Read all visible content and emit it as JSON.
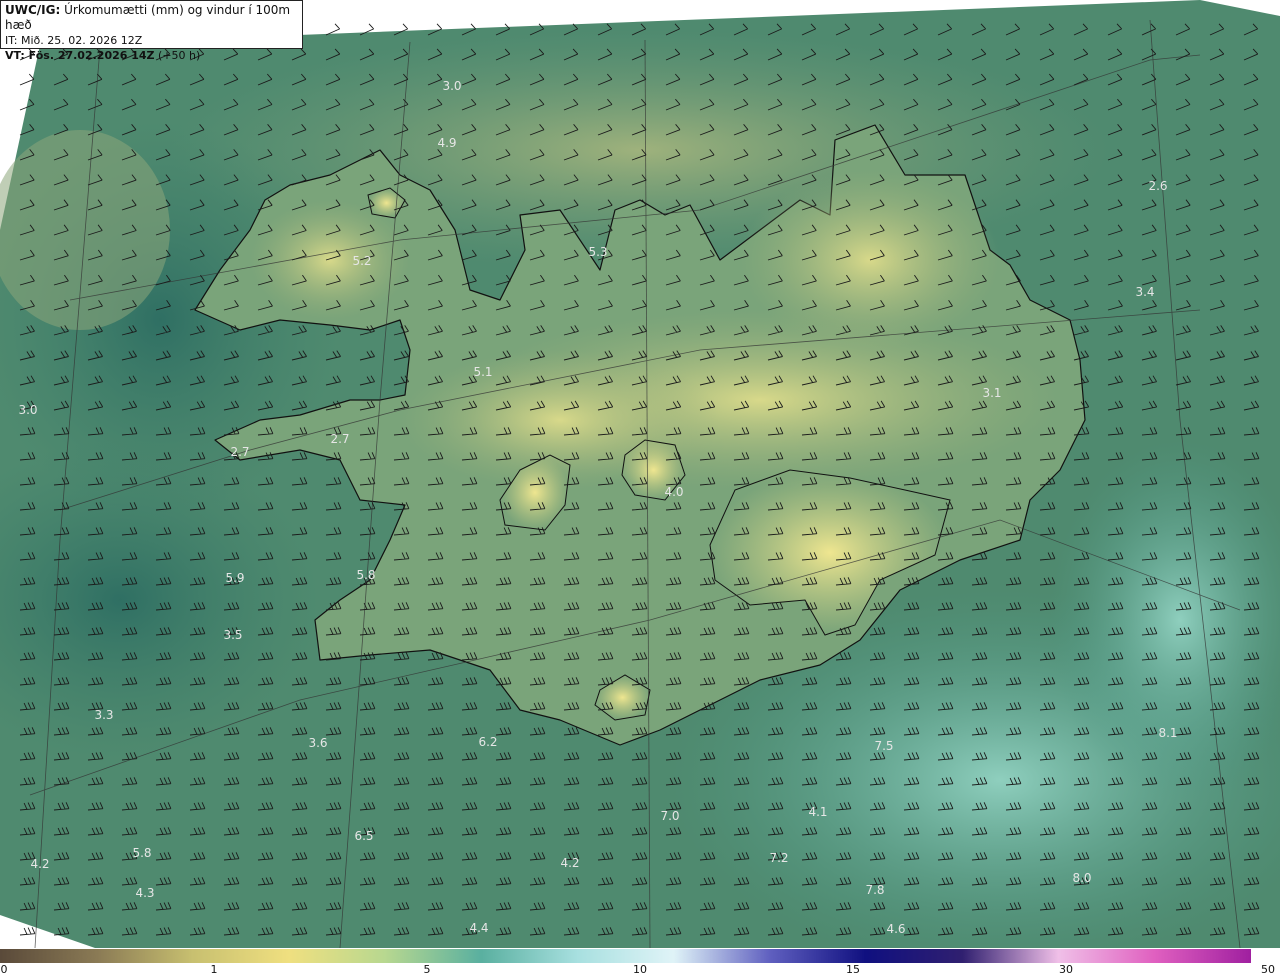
{
  "info": {
    "model": "UWC/IG:",
    "title": "Úrkomumætti (mm) og vindur í 100m hæð",
    "init_time": "IT: Mið. 25. 02. 2026 12Z",
    "valid_label": "VT: Fös. 27.02.2026 14Z",
    "valid_offset": " (+50 h)"
  },
  "colorbar": {
    "ticks": [
      "0",
      "1",
      "5",
      "10",
      "15",
      "30",
      "50"
    ],
    "colors": [
      "#5a4a3a",
      "#8a7a55",
      "#c8c070",
      "#f0e080",
      "#b8d890",
      "#5ab0a0",
      "#a8e0e0",
      "#e0f4f8",
      "#6060c0",
      "#101080",
      "#302070",
      "#f0c0e8",
      "#e060c0",
      "#a020a0"
    ]
  },
  "map_values": [
    {
      "text": "3.0"
    },
    {
      "text": "4.9"
    },
    {
      "text": "2.6"
    },
    {
      "text": "5.2"
    },
    {
      "text": "5.3"
    },
    {
      "text": "3.4"
    },
    {
      "text": "5.1"
    },
    {
      "text": "3.1"
    },
    {
      "text": "3.0"
    },
    {
      "text": "2.7"
    },
    {
      "text": "2.7"
    },
    {
      "text": "4.0"
    },
    {
      "text": "5.9"
    },
    {
      "text": "5.8"
    },
    {
      "text": "3.5"
    },
    {
      "text": "3.3"
    },
    {
      "text": "3.6"
    },
    {
      "text": "6.2"
    },
    {
      "text": "7.5"
    },
    {
      "text": "8.1"
    },
    {
      "text": "7.0"
    },
    {
      "text": "4.1"
    },
    {
      "text": "6.5"
    },
    {
      "text": "5.8"
    },
    {
      "text": "4.2"
    },
    {
      "text": "4.2"
    },
    {
      "text": "7.2"
    },
    {
      "text": "8.0"
    },
    {
      "text": "4.3"
    },
    {
      "text": "7.8"
    },
    {
      "text": "4.4"
    },
    {
      "text": "4.6"
    }
  ]
}
